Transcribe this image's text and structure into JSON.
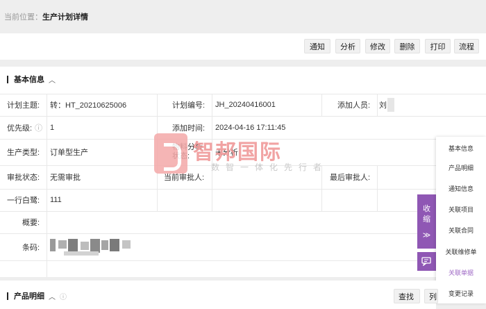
{
  "breadcrumb": {
    "prefix": "当前位置：",
    "current": "生产计划详情"
  },
  "toolbar": {
    "buttons": [
      "通知",
      "分析",
      "修改",
      "删除",
      "打印",
      "流程"
    ]
  },
  "basic_info": {
    "title": "基本信息",
    "chevron": "︿",
    "rows": [
      {
        "label": "计划主题:",
        "value": "转：HT_20210625006",
        "label2": "计划编号:",
        "value2": "JH_20240416001",
        "label3": "添加人员:",
        "value3": "刘"
      },
      {
        "label": "优先级:",
        "info_icon": "ⓘ",
        "value": "1",
        "label2": "添加时间:",
        "value2": "2024-04-16 17:11:45"
      },
      {
        "label": "生产类型:",
        "value": "订单型生产",
        "label2": "物料分析状态:",
        "value2": "未分析"
      },
      {
        "label": "审批状态:",
        "value": "无需审批",
        "label2": "当前审批人:",
        "value2": "",
        "label3": "最后审批人:",
        "value3": ""
      },
      {
        "label": "一行白鹭:",
        "value": "111"
      },
      {
        "label": "概要:",
        "value": ""
      },
      {
        "label": "条码:"
      }
    ]
  },
  "watermark": {
    "title": "智邦国际",
    "subtitle": "数智一体化先行者"
  },
  "side_toggle": {
    "label_1": "收",
    "label_2": "缩",
    "arrow": "≫"
  },
  "side_menu": {
    "items": [
      "基本信息",
      "产品明细",
      "通知信息",
      "关联项目",
      "关联合同",
      "关联维修单",
      "关联单据",
      "变更记录"
    ],
    "active_index": 6,
    "accent": "#8f57b4"
  },
  "product_section": {
    "title": "产品明细",
    "chevron": "︿",
    "info_icon": "ⓘ",
    "buttons": [
      "查找",
      "列"
    ]
  }
}
